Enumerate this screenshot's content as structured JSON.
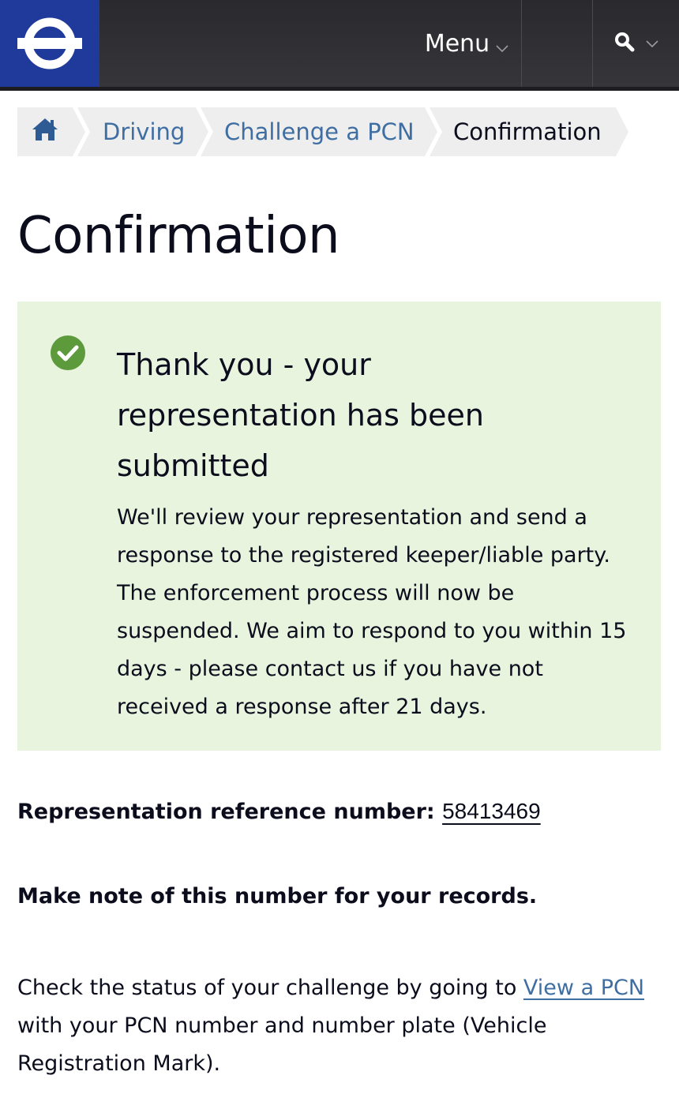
{
  "header": {
    "menu_label": "Menu"
  },
  "breadcrumb": {
    "items": [
      {
        "label": "Driving"
      },
      {
        "label": "Challenge a PCN"
      },
      {
        "label": "Confirmation"
      }
    ]
  },
  "page": {
    "title": "Confirmation"
  },
  "panel": {
    "title": "Thank you - your representation has been submitted",
    "body": "We'll review your representation and send a response to the registered keeper/liable party. The enforcement process will now be suspended. We aim to respond to you within 15 days - please contact us if you have not received a response after 21 days."
  },
  "reference": {
    "label": "Representation reference number:",
    "number": "58413469"
  },
  "note": "Make note of this number for your records.",
  "status": {
    "prefix": "Check the status of your challenge by going to ",
    "link": "View a PCN",
    "suffix": " with your PCN number and number plate (Vehicle Registration Mark)."
  },
  "colors": {
    "header_bg": "#2f2f33",
    "logo_bg": "#1f3a9a",
    "link": "#3f6ea3",
    "panel_bg": "#e9f4df",
    "success_green": "#5d9a3c"
  },
  "icons": [
    "roundel-logo",
    "chevron-down-icon",
    "search-icon",
    "home-icon",
    "check-circle-icon"
  ]
}
